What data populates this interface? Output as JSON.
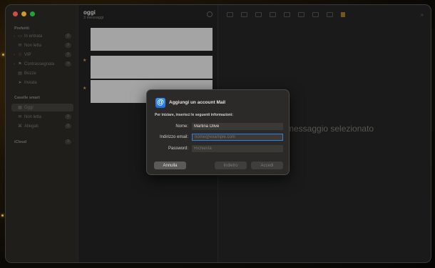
{
  "window": {
    "traffic_lights": [
      "close",
      "minimize",
      "zoom"
    ]
  },
  "sidebar": {
    "favorites": {
      "title": "Preferiti",
      "items": [
        {
          "label": "In entrata",
          "icon": "inbox-icon",
          "count": "0"
        },
        {
          "label": "Non letta",
          "icon": "unread-icon",
          "count": "0"
        },
        {
          "label": "VIP",
          "icon": "star-icon",
          "count": "0"
        },
        {
          "label": "Contrassegnata",
          "icon": "flag-icon",
          "count": "0"
        },
        {
          "label": "Bozze",
          "icon": "draft-icon",
          "count": ""
        },
        {
          "label": "Inviata",
          "icon": "sent-icon",
          "count": ""
        }
      ]
    },
    "smart": {
      "title": "Caselle smart",
      "items": [
        {
          "label": "Oggi",
          "icon": "calendar-icon",
          "count": ""
        },
        {
          "label": "Non letta",
          "icon": "unread-icon",
          "count": "0"
        },
        {
          "label": "Allegati",
          "icon": "attachment-icon",
          "count": "0"
        }
      ]
    },
    "icloud": {
      "title": "iCloud",
      "count": "0"
    }
  },
  "message_list": {
    "title": "oggi",
    "subtitle": "3 messaggi"
  },
  "preview": {
    "empty_text": "messaggio selezionato"
  },
  "dialog": {
    "title": "Aggiungi un account Mail",
    "intro": "Per iniziare, inserisci le seguenti informazioni:",
    "name_label": "Nome:",
    "name_value": "Martina Olive",
    "email_label": "Indirizzo email:",
    "email_placeholder": "nome@example.com",
    "password_label": "Password:",
    "password_placeholder": "Richiesta",
    "cancel_label": "Annulla",
    "back_label": "Indietro",
    "signin_label": "Accedi",
    "accent_color": "#2c7ff0"
  }
}
